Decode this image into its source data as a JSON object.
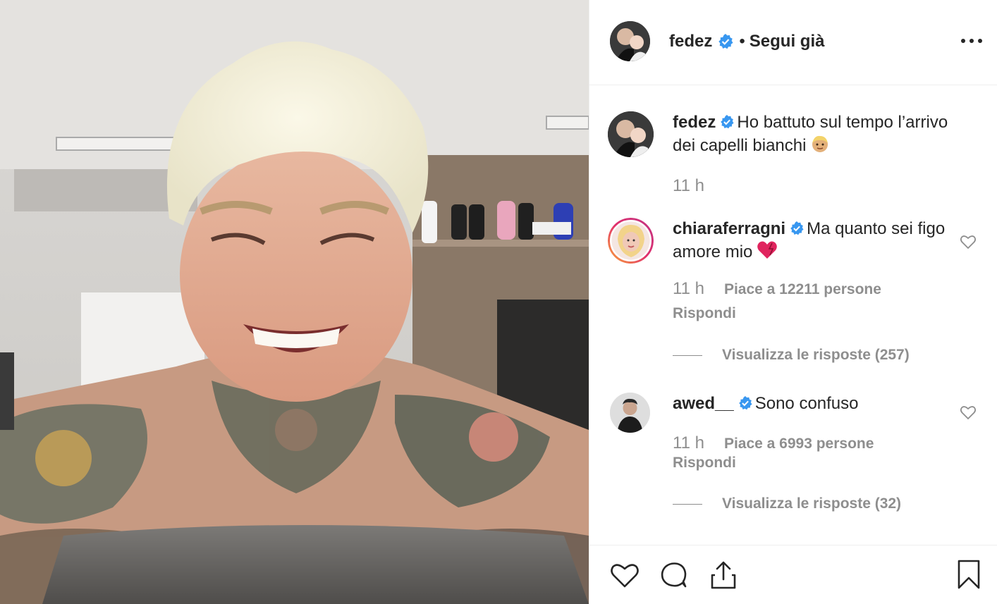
{
  "post": {
    "author": {
      "username": "fedez",
      "verified": true,
      "follow_status": "Segui già",
      "separator": "•"
    },
    "caption": {
      "username": "fedez",
      "text": "Ho battuto sul tempo l’arrivo dei capelli bianchi",
      "emoji": "blond-child-emoji",
      "time": "11 h"
    },
    "comments": [
      {
        "username": "chiaraferragni",
        "verified": true,
        "text": "Ma quanto sei figo amore mio",
        "emoji": "heart-emoji",
        "time": "11 h",
        "likes": "Piace a 12211 persone",
        "reply_label": "Rispondi",
        "view_replies": "Visualizza le risposte (257)"
      },
      {
        "username": "awed__",
        "verified": true,
        "text": "Sono confuso",
        "time": "11 h",
        "likes": "Piace a 6993 persone",
        "reply_label": "Rispondi",
        "view_replies": "Visualizza le risposte (32)"
      }
    ],
    "actions": {
      "like_icon": "heart-outline-icon",
      "comment_icon": "comment-bubble-icon",
      "share_icon": "share-upload-icon",
      "save_icon": "bookmark-icon"
    }
  },
  "colors": {
    "text_primary": "#262626",
    "text_secondary": "#8e8e8e",
    "verified_blue": "#3897f0",
    "border": "#efefef"
  }
}
